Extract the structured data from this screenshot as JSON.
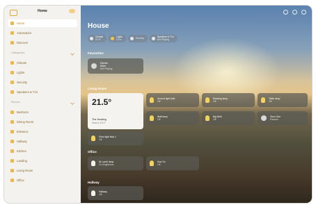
{
  "sidebar": {
    "title": "Home",
    "items": [
      {
        "label": "Home",
        "active": true,
        "icon": "house-icon"
      },
      {
        "label": "Automation",
        "icon": "clock-icon"
      },
      {
        "label": "Discover",
        "icon": "star-icon"
      }
    ],
    "categories_label": "Categories",
    "categories": [
      {
        "label": "Climate",
        "icon": "climate-icon"
      },
      {
        "label": "Lights",
        "icon": "bulb-icon"
      },
      {
        "label": "Security",
        "icon": "lock-icon"
      },
      {
        "label": "Speakers & TVs",
        "icon": "tv-icon"
      }
    ],
    "rooms_label": "Rooms",
    "rooms": [
      {
        "label": "Bedroom"
      },
      {
        "label": "Dining Room"
      },
      {
        "label": "Entrance"
      },
      {
        "label": "Hallway"
      },
      {
        "label": "Kitchen"
      },
      {
        "label": "Landing"
      },
      {
        "label": "Living Room"
      },
      {
        "label": "Office"
      }
    ]
  },
  "main": {
    "title": "House",
    "chips": [
      {
        "label": "Climate",
        "sub": "21.5°",
        "icon": "climate-icon"
      },
      {
        "label": "Lights",
        "sub": "5 On",
        "icon": "bulb-icon"
      },
      {
        "label": "Security",
        "sub": "",
        "icon": "lock-icon"
      },
      {
        "label": "Speakers & TVs",
        "sub": "Not Playing",
        "icon": "tv-icon"
      }
    ],
    "favourites_label": "Favourites",
    "favourite_tile": {
      "name": "Kitchen",
      "sub": "Mixer",
      "state": "Not Playing"
    },
    "living_label": "Living Room",
    "thermostat": {
      "temp": "21.5°",
      "name": "The Heating",
      "sub": "Heat to 18.0°"
    },
    "living_tiles": [
      {
        "name": "Around light bulb",
        "sub": "Off"
      },
      {
        "name": "Reading lamp",
        "sub": "Off"
      },
      {
        "name": "Table lamp",
        "sub": "Off"
      },
      {
        "name": "Wall lamp",
        "sub": "Off"
      },
      {
        "name": "Big Bulb",
        "sub": "Off"
      },
      {
        "name": "Xbox One",
        "sub": "Paused"
      },
      {
        "name": "Floor light strip 1",
        "sub": "Off"
      }
    ],
    "office_label": "Office",
    "office_tiles": [
      {
        "name": "Nr Lamb lamp",
        "sub": "On Brightness"
      },
      {
        "name": "Hue Go",
        "sub": "Off"
      }
    ],
    "hallway_label": "Hallway",
    "hallway_tiles": [
      {
        "name": "Hallway",
        "sub": "Off"
      }
    ]
  }
}
